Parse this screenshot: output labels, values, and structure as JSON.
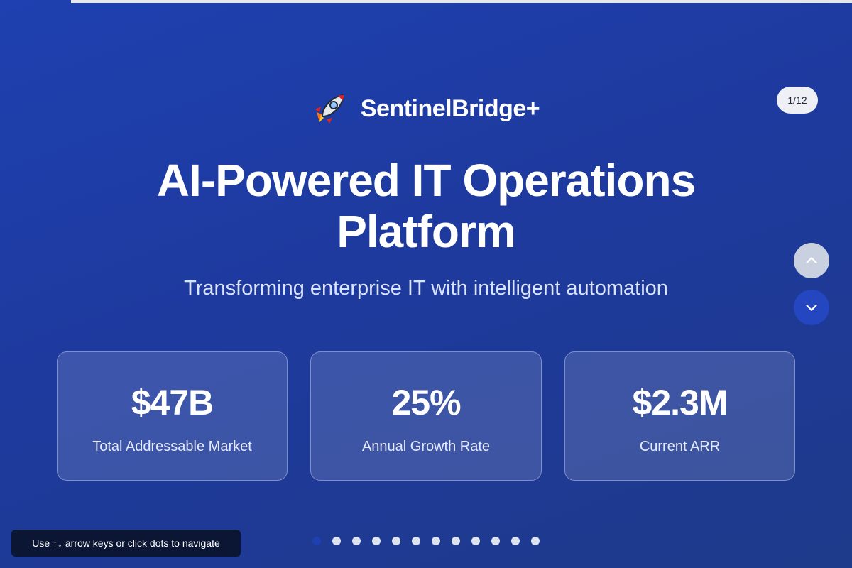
{
  "progress": {
    "fraction": 0.0833
  },
  "slide_counter": "1/12",
  "brand": {
    "icon": "rocket-icon",
    "name": "SentinelBridge+"
  },
  "title": "AI-Powered IT Operations Platform",
  "subtitle": "Transforming enterprise IT with intelligent automation",
  "stats": [
    {
      "value": "$47B",
      "label": "Total Addressable Market"
    },
    {
      "value": "25%",
      "label": "Annual Growth Rate"
    },
    {
      "value": "$2.3M",
      "label": "Current ARR"
    }
  ],
  "nav": {
    "up_icon": "chevron-up-icon",
    "down_icon": "chevron-down-icon"
  },
  "pagination": {
    "total": 12,
    "active": 1
  },
  "hint": "Use ↑↓ arrow keys or click dots to navigate",
  "colors": {
    "background": "#1e3a9e",
    "active_dot": "#1e40b0",
    "hint_background": "#0b1634"
  }
}
